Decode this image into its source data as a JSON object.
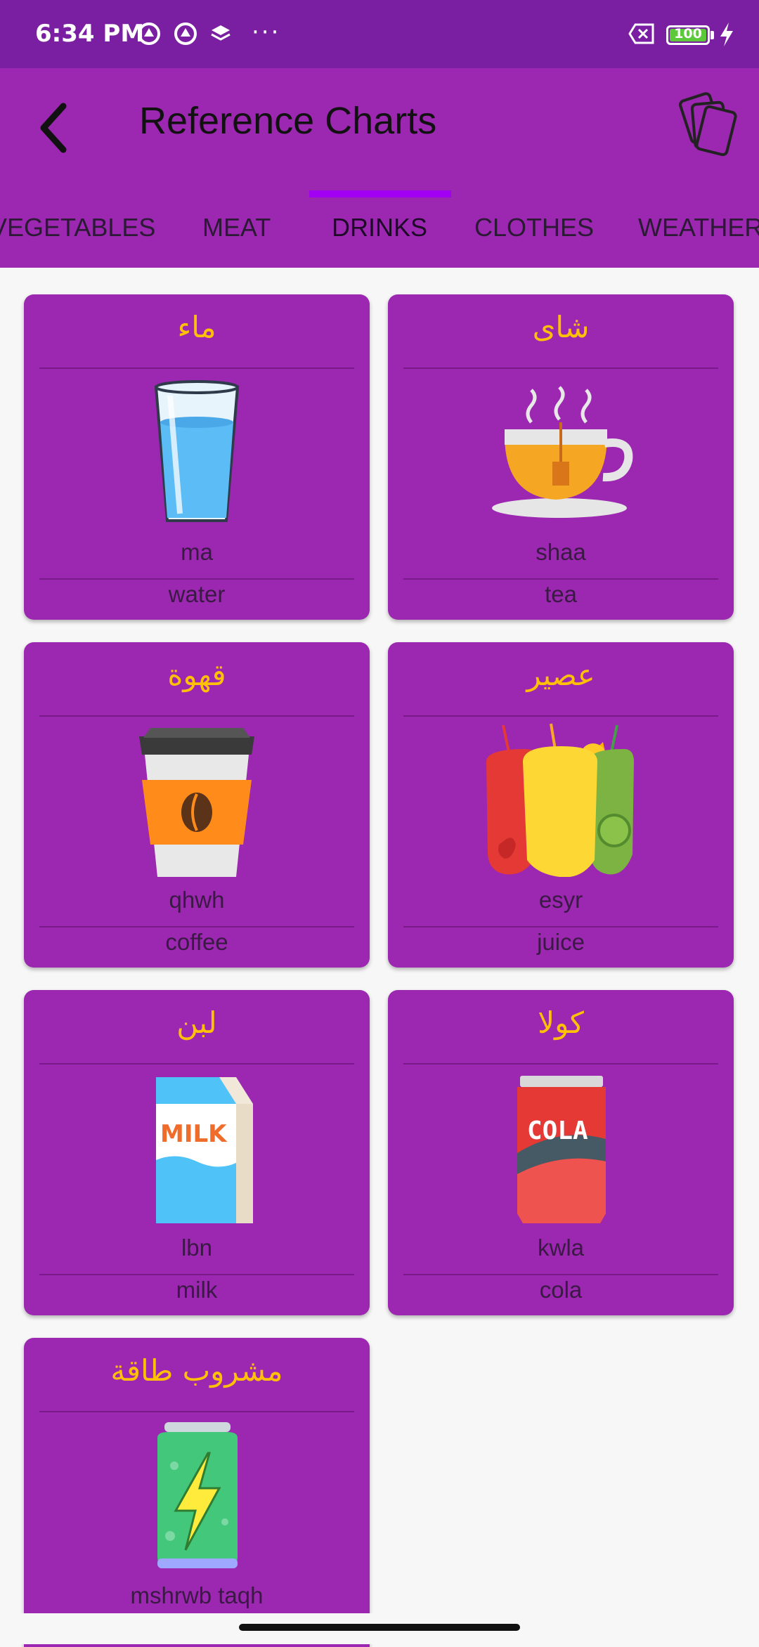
{
  "status_bar": {
    "time": "6:34 PM",
    "more": "···",
    "battery": "100"
  },
  "app_bar": {
    "title": "Reference Charts"
  },
  "tabs": [
    {
      "label": "Vegetables"
    },
    {
      "label": "Meat"
    },
    {
      "label": "Drinks",
      "active": true
    },
    {
      "label": "Clothes"
    },
    {
      "label": "Weather"
    }
  ],
  "cards": [
    {
      "arabic": "ماء",
      "translit": "ma",
      "english": "water",
      "icon": "water-glass-icon"
    },
    {
      "arabic": "شاى",
      "translit": "shaa",
      "english": "tea",
      "icon": "tea-cup-icon"
    },
    {
      "arabic": "قهوة",
      "translit": "qhwh",
      "english": "coffee",
      "icon": "coffee-cup-icon"
    },
    {
      "arabic": "عصير",
      "translit": "esyr",
      "english": "juice",
      "icon": "juice-glasses-icon"
    },
    {
      "arabic": "لبن",
      "translit": "lbn",
      "english": "milk",
      "icon": "milk-carton-icon"
    },
    {
      "arabic": "كولا",
      "translit": "kwla",
      "english": "cola",
      "icon": "cola-can-icon"
    },
    {
      "arabic": "مشروب طاقة",
      "translit": "mshrwb taqh",
      "english": "",
      "icon": "energy-drink-can-icon"
    }
  ],
  "colors": {
    "status_bar": "#7b1fa2",
    "app_bar": "#9c27b0",
    "card": "#9c27b0",
    "arabic_text": "#ffc107",
    "tab_indicator": "#a100f2"
  }
}
